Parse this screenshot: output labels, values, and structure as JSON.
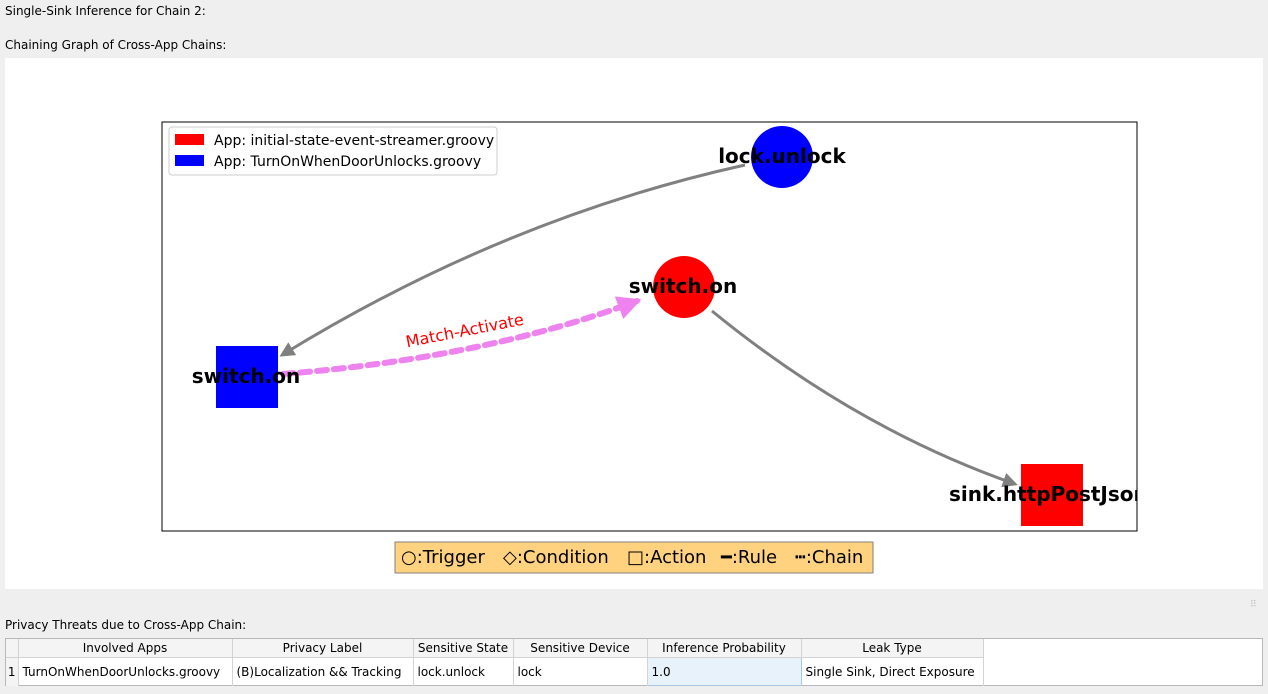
{
  "labels": {
    "inference": "Single-Sink Inference for Chain 2:",
    "graph": "Chaining Graph of Cross-App Chains:",
    "threats": "Privacy Threats due to Cross-App Chain:"
  },
  "graph": {
    "legend": [
      {
        "label": "App: initial-state-event-streamer.groovy",
        "color": "#ff0000"
      },
      {
        "label": "App: TurnOnWhenDoorUnlocks.groovy",
        "color": "#0000ff"
      }
    ],
    "nodes": {
      "lock_unlock": {
        "label": "lock.unlock",
        "kind": "trigger",
        "color": "#0000ff"
      },
      "switch_on_red": {
        "label": "switch.on",
        "kind": "trigger",
        "color": "#ff0000"
      },
      "switch_on_blue": {
        "label": "switch.on",
        "kind": "action",
        "color": "#0000ff"
      },
      "sink": {
        "label": "sink.httpPostJson",
        "kind": "action",
        "color": "#ff0000"
      }
    },
    "edges": {
      "match_label": "Match-Activate",
      "rule_color": "#808080",
      "chain_color": "#ee82ee",
      "match_label_color": "#ff0000"
    },
    "key": {
      "trigger": "○:Trigger",
      "condition": "◇:Condition",
      "action": "□:Action",
      "rule": "━:Rule",
      "chain": "┅:Chain",
      "background": "#ffd280"
    }
  },
  "table": {
    "headers": [
      "Involved Apps",
      "Privacy Label",
      "Sensitive State",
      "Sensitive Device",
      "Inference Probability",
      "Leak Type"
    ],
    "rows": [
      {
        "index": "1",
        "cells": [
          "TurnOnWhenDoorUnlocks.groovy",
          "(B)Localization && Tracking",
          "lock.unlock",
          "lock",
          "1.0",
          "Single Sink, Direct Exposure"
        ]
      }
    ]
  }
}
